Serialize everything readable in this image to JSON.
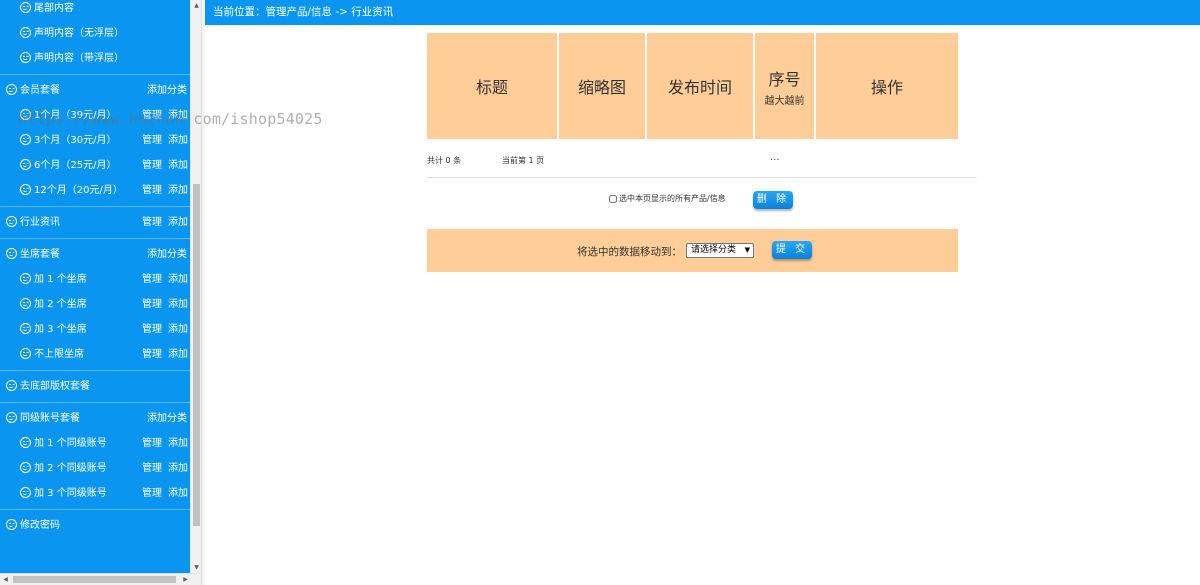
{
  "sidebar": {
    "top_items": [
      {
        "label": "尾部内容"
      },
      {
        "label": "声明内容（无浮层）"
      },
      {
        "label": "声明内容（带浮层）"
      }
    ],
    "membership": {
      "title": "会员套餐",
      "add_category": "添加分类",
      "items": [
        {
          "label": "1个月（39元/月）",
          "manage": "管理",
          "add": "添加"
        },
        {
          "label": "3个月（30元/月）",
          "manage": "管理",
          "add": "添加"
        },
        {
          "label": "6个月（25元/月）",
          "manage": "管理",
          "add": "添加"
        },
        {
          "label": "12个月（20元/月）",
          "manage": "管理",
          "add": "添加"
        }
      ]
    },
    "news": {
      "title": "行业资讯",
      "manage": "管理",
      "add": "添加"
    },
    "seats": {
      "title": "坐席套餐",
      "add_category": "添加分类",
      "items": [
        {
          "label": "加 1 个坐席",
          "manage": "管理",
          "add": "添加"
        },
        {
          "label": "加 2 个坐席",
          "manage": "管理",
          "add": "添加"
        },
        {
          "label": "加 3 个坐席",
          "manage": "管理",
          "add": "添加"
        },
        {
          "label": "不上限坐席",
          "manage": "管理",
          "add": "添加"
        }
      ]
    },
    "remove_copyright": {
      "title": "去底部版权套餐"
    },
    "accounts": {
      "title": "同级账号套餐",
      "add_category": "添加分类",
      "items": [
        {
          "label": "加 1 个同级账号",
          "manage": "管理",
          "add": "添加"
        },
        {
          "label": "加 2 个同级账号",
          "manage": "管理",
          "add": "添加"
        },
        {
          "label": "加 3 个同级账号",
          "manage": "管理",
          "add": "添加"
        }
      ]
    },
    "change_password": {
      "title": "修改密码"
    }
  },
  "header": {
    "location": "当前位置：管理产品/信息 -> 行业资讯"
  },
  "watermark": "https://www.huzhan.com/ishop54025",
  "table": {
    "columns": [
      {
        "label": "标题"
      },
      {
        "label": "缩略图"
      },
      {
        "label": "发布时间"
      },
      {
        "label": "序号",
        "sub": "越大越前"
      },
      {
        "label": "操作"
      }
    ]
  },
  "pager": {
    "total": "共计 0 条",
    "current": "当前第 1 页",
    "more": "..."
  },
  "actions": {
    "select_all_label": "选中本页显示的所有产品/信息",
    "delete_label": "删 除",
    "move_label": "将选中的数据移动到：",
    "select_value": "请选择分类",
    "submit_label": "提 交"
  },
  "colors": {
    "accent": "#0a96f0",
    "header_bg": "#fecd98",
    "text": "#333333"
  }
}
